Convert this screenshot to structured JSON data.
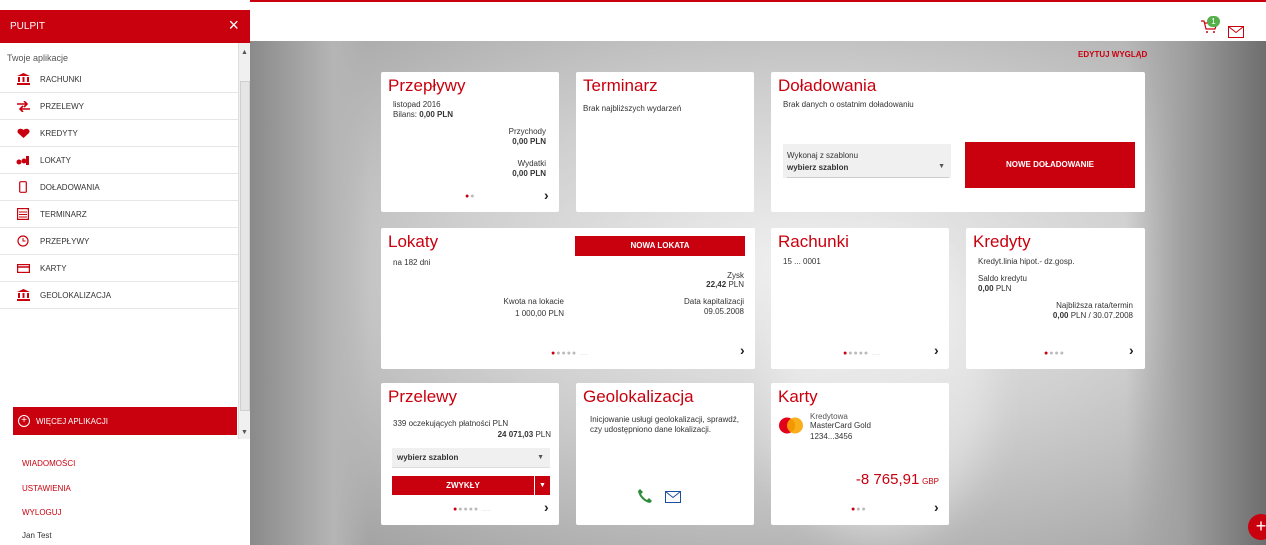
{
  "sidebar": {
    "title": "PULPIT",
    "close_symbol": "×",
    "subtitle": "Twoje aplikacje",
    "items": [
      {
        "label": "RACHUNKI",
        "icon": "bank-icon"
      },
      {
        "label": "PRZELEWY",
        "icon": "transfer-arrows-icon"
      },
      {
        "label": "KREDYTY",
        "icon": "heart-hand-icon"
      },
      {
        "label": "LOKATY",
        "icon": "coins-icon"
      },
      {
        "label": "DOŁADOWANIA",
        "icon": "phone-icon"
      },
      {
        "label": "TERMINARZ",
        "icon": "calendar-icon"
      },
      {
        "label": "PRZEPŁYWY",
        "icon": "clock-icon"
      },
      {
        "label": "KARTY",
        "icon": "card-icon"
      },
      {
        "label": "GEOLOKALIZACJA",
        "icon": "bank-icon"
      }
    ],
    "more_apps": "WIĘCEJ APLIKACJI",
    "links": [
      "WIADOMOŚCI",
      "USTAWIENIA",
      "WYLOGUJ"
    ],
    "user": "Jan Test"
  },
  "topbar": {
    "cart_count": "1"
  },
  "edit_layout": "EDYTUJ WYGLĄD",
  "tiles": {
    "przeplywy": {
      "title": "Przepływy",
      "period": "listopad 2016",
      "balance_label": "Bilans:",
      "balance_value": "0,00 PLN",
      "income_label": "Przychody",
      "income_value": "0,00 PLN",
      "expense_label": "Wydatki",
      "expense_value": "0,00 PLN"
    },
    "terminarz": {
      "title": "Terminarz",
      "empty": "Brak najbliższych wydarzeń"
    },
    "doladowania": {
      "title": "Doładowania",
      "empty": "Brak danych o ostatnim doładowaniu",
      "template_label": "Wykonaj z szablonu",
      "template_select": "wybierz szablon",
      "button": "NOWE DOŁADOWANIE"
    },
    "lokaty": {
      "title": "Lokaty",
      "term": "na 182 dni",
      "button": "NOWA LOKATA",
      "profit_label": "Zysk",
      "profit_value": "22,42",
      "profit_currency": "PLN",
      "amount_label": "Kwota na lokacie",
      "amount_value": "1 000,00",
      "amount_currency": "PLN",
      "cap_label": "Data kapitalizacji",
      "cap_value": "09.05.2008"
    },
    "rachunki": {
      "title": "Rachunki",
      "account": "15 ... 0001"
    },
    "kredyty": {
      "title": "Kredyty",
      "name": "Kredyt.linia hipot.- dz.gosp.",
      "saldo_label": "Saldo kredytu",
      "saldo_value": "0,00",
      "saldo_currency": "PLN",
      "rate_label": "Najbliższa rata/termin",
      "rate_value": "0,00",
      "rate_rest": "PLN / 30.07.2008"
    },
    "przelewy": {
      "title": "Przelewy",
      "pending": "339 oczekujących płatności PLN",
      "amount": "24 071,03",
      "currency": "PLN",
      "select": "wybierz szablon",
      "button": "ZWYKŁY"
    },
    "geolokalizacja": {
      "title": "Geolokalizacja",
      "text": "Inicjowanie usługi geolokalizacji, sprawdź, czy udostępniono dane lokalizacji."
    },
    "karty": {
      "title": "Karty",
      "type": "Kredytowa",
      "name": "MasterCard Gold",
      "number": "1234...3456",
      "logo_text": "MasterCard",
      "balance": "-8 765,91",
      "currency": "GBP"
    }
  },
  "pager_ellipsis": "...",
  "colors": {
    "brand": "#c9000e",
    "badge": "#55b04a"
  }
}
